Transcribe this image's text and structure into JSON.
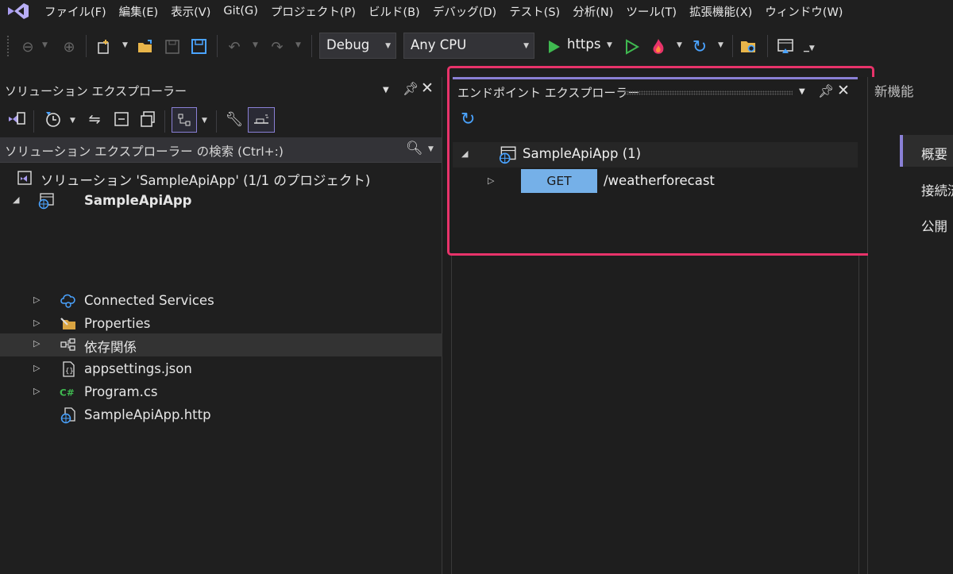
{
  "menu": [
    "ファイル(F)",
    "編集(E)",
    "表示(V)",
    "Git(G)",
    "プロジェクト(P)",
    "ビルド(B)",
    "デバッグ(D)",
    "テスト(S)",
    "分析(N)",
    "ツール(T)",
    "拡張機能(X)",
    "ウィンドウ(W)"
  ],
  "toolbar": {
    "configuration": "Debug",
    "platform": "Any CPU",
    "run_profile": "https"
  },
  "solution_explorer": {
    "title": "ソリューション エクスプローラー",
    "search_placeholder": "ソリューション エクスプローラー の検索 (Ctrl+:)",
    "solution_label": "ソリューション 'SampleApiApp' (1/1 のプロジェクト)",
    "project": "SampleApiApp",
    "items": [
      "Connected Services",
      "Properties",
      "依存関係",
      "appsettings.json",
      "Program.cs",
      "SampleApiApp.http"
    ]
  },
  "endpoint_explorer": {
    "title": "エンドポイント エクスプローラー",
    "project": "SampleApiApp (1)",
    "endpoint_verb": "GET",
    "endpoint_path": "/weatherforecast"
  },
  "right_panel": {
    "title": "新機能",
    "items": [
      "概要",
      "接続済",
      "公開"
    ]
  },
  "colors": {
    "accent_purple": "#8a80d6",
    "highlight_pink": "#e8336a",
    "get_badge": "#75b0e8",
    "play_green": "#3fb950"
  }
}
